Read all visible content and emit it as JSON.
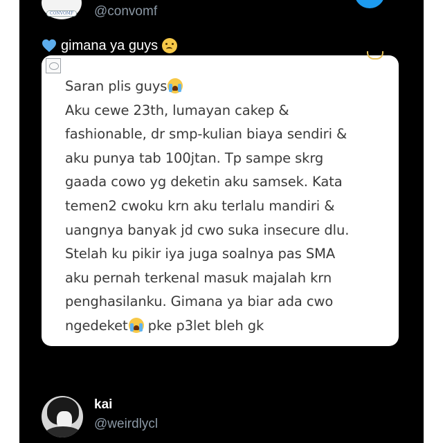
{
  "top_user": {
    "avatar_text": "CONVOMF",
    "handle": "@convomf"
  },
  "caption": {
    "text": "gimana ya guys",
    "leading_icon": "blue-heart",
    "trailing_icon": "sad-face-emoji"
  },
  "card": {
    "lines": [
      "Saran plis guys",
      "Aku cewe 23th, lumayan cakep &",
      "fashionable, dr smp-kulian biaya sendiri &",
      "aku punya tab 100jtan. Tp sampe skrg",
      "gaada cowo yg deketin aku samsek. Kata",
      "temen2 cwoku krn aku terlalu mandiri &",
      "uangnya banyak jd cwo suka insecure dlu.",
      "Stelah ku pikir iya juga soalnya pas SMA",
      "aku pernah terkenal masuk majalah krn",
      "penghasilanku. Gimana ya biar ada cwo",
      "ngedeket",
      " pke p3let bleh gk"
    ]
  },
  "bottom_user": {
    "display_name": "kai",
    "handle": "@weirdlycl"
  },
  "colors": {
    "background": "#000000",
    "card": "#ffffff",
    "handle": "#8b98a5",
    "accent": "#1d9bf0"
  }
}
